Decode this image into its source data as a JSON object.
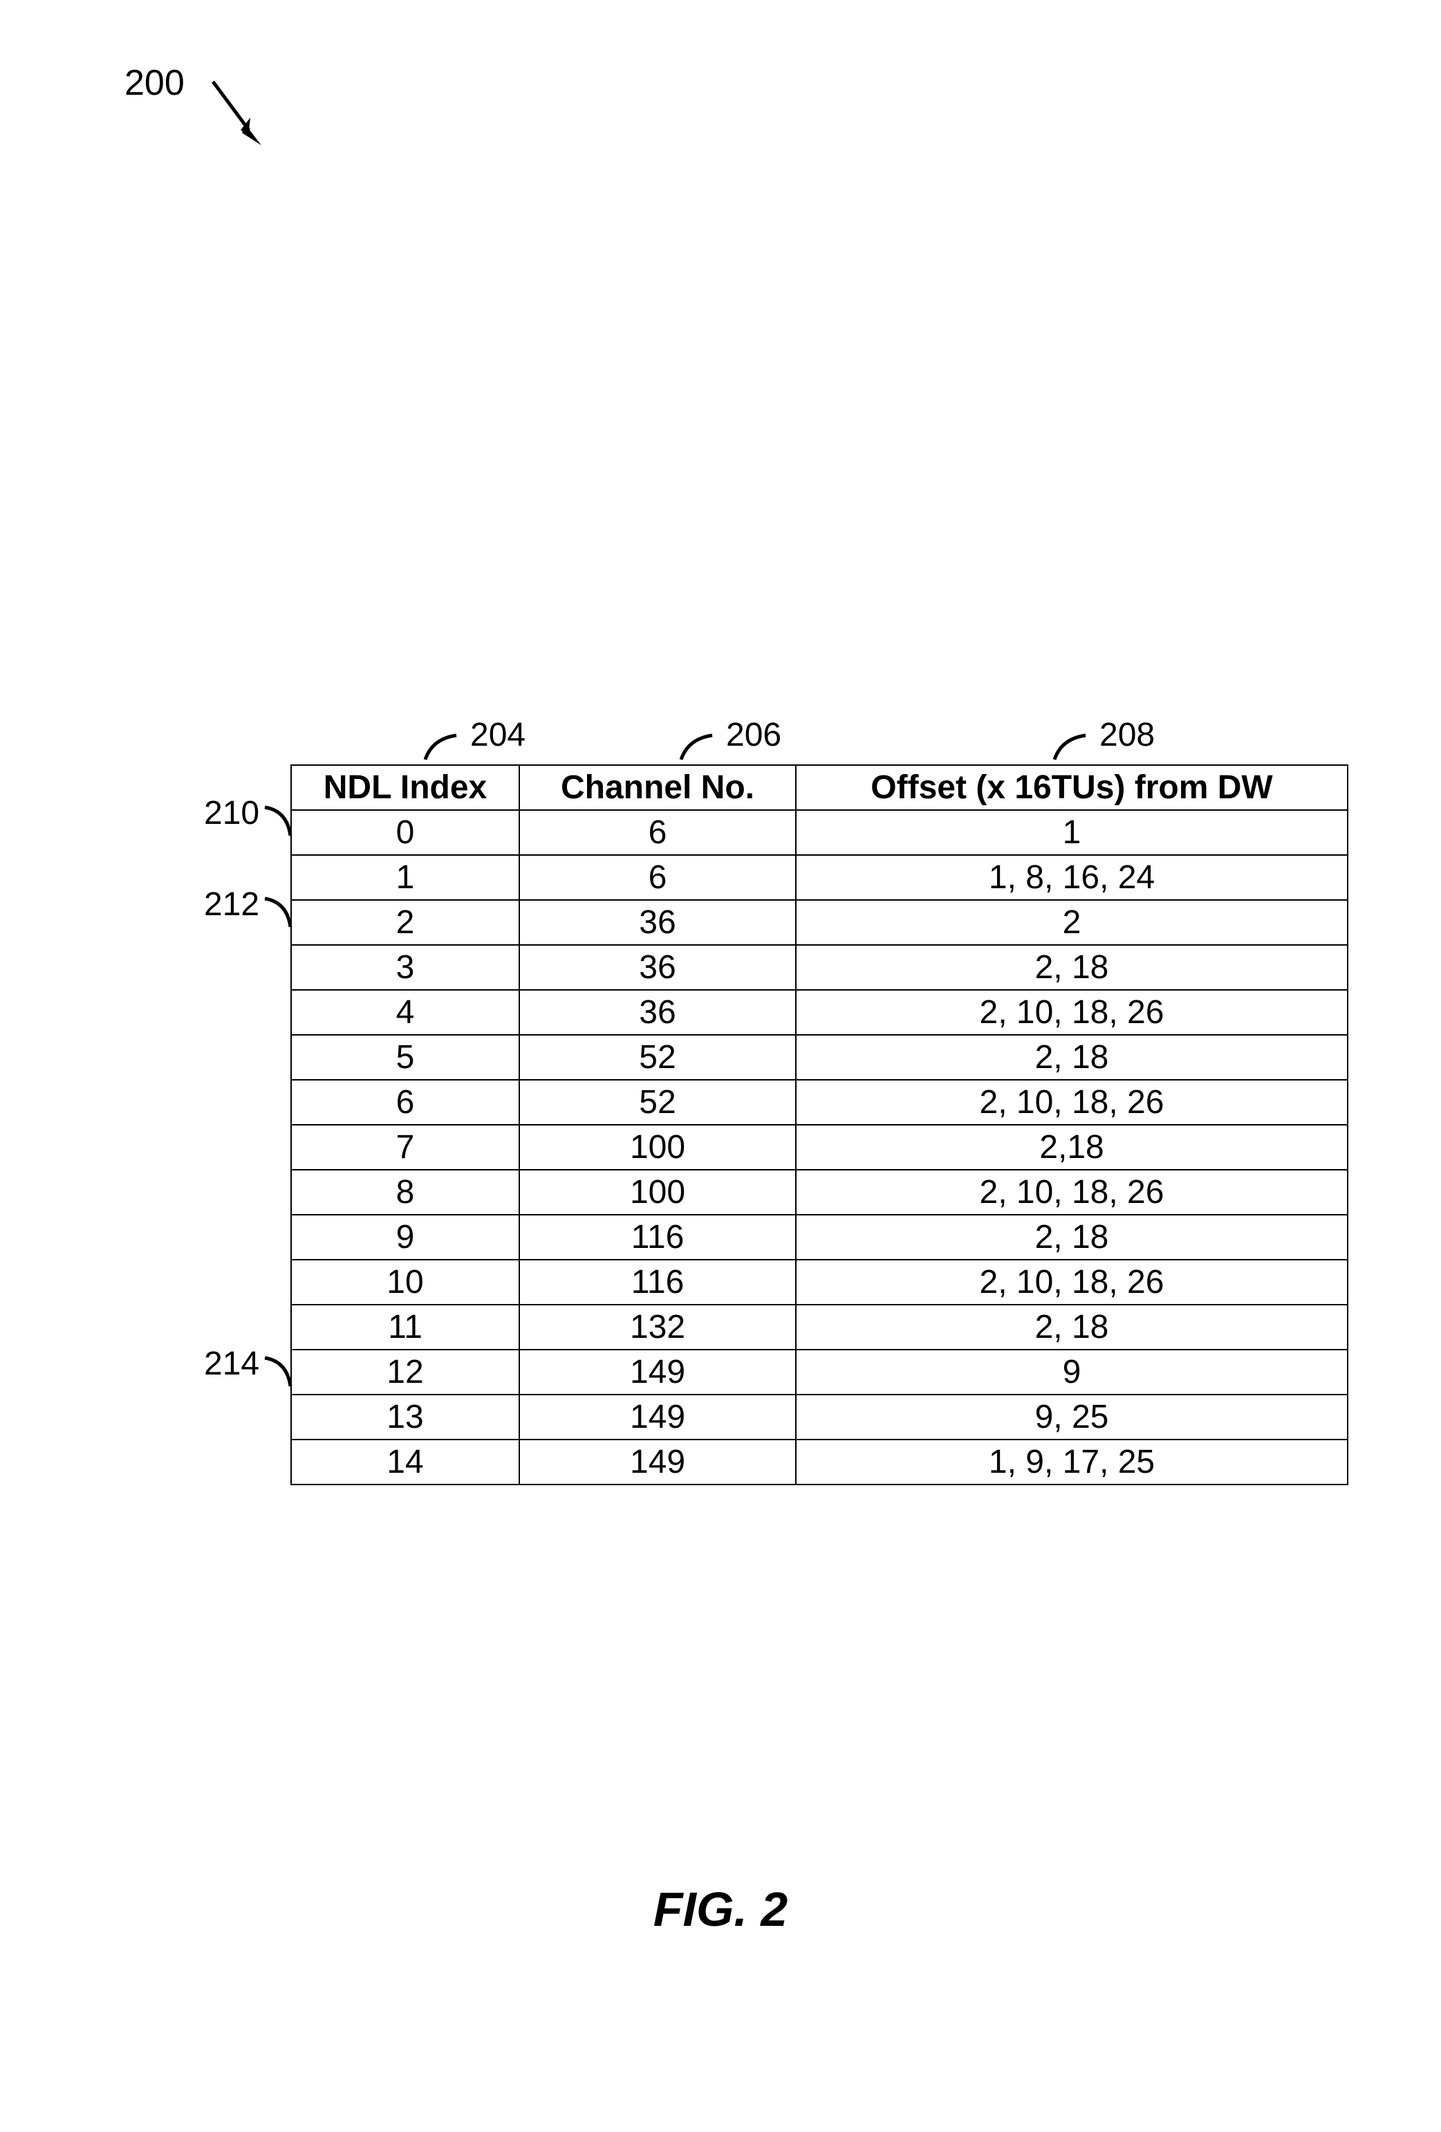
{
  "figureNumber": "200",
  "columnCallouts": {
    "col1": "204",
    "col2": "206",
    "col3": "208"
  },
  "rowCallouts": {
    "r210": "210",
    "r212": "212",
    "r214": "214"
  },
  "headers": {
    "ndl": "NDL Index",
    "channel": "Channel No.",
    "offset": "Offset (x 16TUs) from DW"
  },
  "rows": [
    {
      "ndl": "0",
      "channel": "6",
      "offset": "1"
    },
    {
      "ndl": "1",
      "channel": "6",
      "offset": "1, 8, 16, 24"
    },
    {
      "ndl": "2",
      "channel": "36",
      "offset": "2"
    },
    {
      "ndl": "3",
      "channel": "36",
      "offset": "2, 18"
    },
    {
      "ndl": "4",
      "channel": "36",
      "offset": "2, 10, 18, 26"
    },
    {
      "ndl": "5",
      "channel": "52",
      "offset": "2, 18"
    },
    {
      "ndl": "6",
      "channel": "52",
      "offset": "2, 10, 18, 26"
    },
    {
      "ndl": "7",
      "channel": "100",
      "offset": "2,18"
    },
    {
      "ndl": "8",
      "channel": "100",
      "offset": "2, 10, 18, 26"
    },
    {
      "ndl": "9",
      "channel": "116",
      "offset": "2, 18"
    },
    {
      "ndl": "10",
      "channel": "116",
      "offset": "2, 10, 18, 26"
    },
    {
      "ndl": "11",
      "channel": "132",
      "offset": "2, 18"
    },
    {
      "ndl": "12",
      "channel": "149",
      "offset": "9"
    },
    {
      "ndl": "13",
      "channel": "149",
      "offset": "9, 25"
    },
    {
      "ndl": "14",
      "channel": "149",
      "offset": "1, 9, 17, 25"
    }
  ],
  "caption": "FIG. 2"
}
